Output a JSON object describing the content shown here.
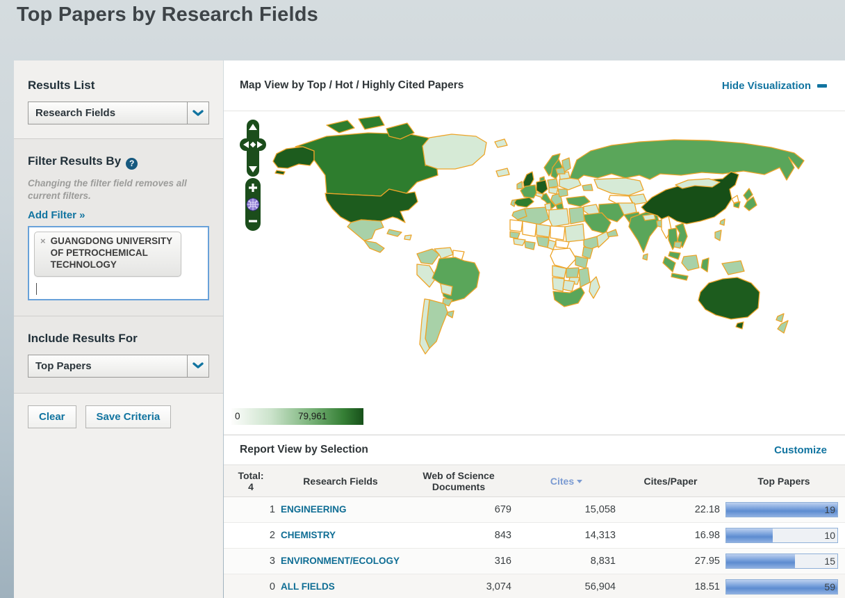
{
  "page": {
    "title": "Top Papers by Research Fields"
  },
  "sidebar": {
    "results_list": {
      "label": "Results List",
      "selected": "Research Fields"
    },
    "filter": {
      "heading": "Filter Results By",
      "help_icon": "?",
      "note": "Changing the filter field removes all current filters.",
      "add_filter_label": "Add Filter »",
      "chip": {
        "remove_icon": "×",
        "label": "GUANGDONG UNIVERSITY OF PETROCHEMICAL TECHNOLOGY"
      }
    },
    "include": {
      "label": "Include Results For",
      "selected": "Top Papers"
    },
    "actions": {
      "clear_label": "Clear",
      "save_label": "Save Criteria"
    }
  },
  "map_section": {
    "title": "Map View by Top / Hot / Highly Cited Papers",
    "hide_link": "Hide Visualization",
    "legend": {
      "min": "0",
      "max": "79,961",
      "min_color": "#ffffff",
      "max_color": "#17501a"
    },
    "border_color": "#eda428",
    "palette": {
      "0": "#ffffff",
      "1": "#f0f7f0",
      "2": "#d6ead6",
      "3": "#a8d1a8",
      "4": "#5aa65a",
      "5": "#2e7d2e",
      "6": "#1d5c1e",
      "7": "#174f17"
    },
    "country_levels": {
      "alaska": 6,
      "aleutians": 6,
      "canada": 5,
      "arctic-island-1": 5,
      "arctic-island-2": 5,
      "baffin": 5,
      "usa": 6,
      "mexico": 3,
      "central-america": 3,
      "cuba": 3,
      "hispaniola": 2,
      "greenland": 2,
      "iceland": 2,
      "svalbard": 2,
      "colombia": 3,
      "venezuela": 2,
      "guyana": 0,
      "peru": 2,
      "brazil": 4,
      "bolivia": 2,
      "paraguay": 3,
      "chile": 2,
      "argentina": 3,
      "uruguay": 3,
      "uk": 6,
      "ireland": 3,
      "france": 4,
      "spain": 5,
      "portugal": 3,
      "germany": 6,
      "italy": 4,
      "norway": 4,
      "sweden": 4,
      "finland": 3,
      "denmark": 4,
      "poland": 3,
      "czech-hungary": 2,
      "balkans": 3,
      "romania": 3,
      "ukraine": 2,
      "belarus": 2,
      "baltics": 3,
      "greece": 4,
      "alps": 2,
      "russia": 4,
      "kazakhstan": 2,
      "central-asia-west": 0,
      "central-asia-east": 2,
      "caucasus": 3,
      "turkey": 4,
      "syria-iraq": 2,
      "saudi-arabia": 4,
      "yemen-oman": 3,
      "iran": 4,
      "afghanistan": 2,
      "pakistan": 4,
      "india": 4,
      "nepal": 2,
      "bangladesh": 3,
      "sri-lanka": 3,
      "myanmar": 0,
      "thailand": 4,
      "vietnam": 4,
      "cambodia": 3,
      "malaysia": 4,
      "china": 7,
      "mongolia": 2,
      "north-korea": 0,
      "south-korea": 4,
      "japan-north": 4,
      "japan-south": 4,
      "taiwan": 3,
      "philippines": 3,
      "sumatra": 4,
      "java": 4,
      "borneo": 3,
      "sulawesi": 4,
      "new-guinea": 3,
      "morocco": 3,
      "algeria": 3,
      "tunisia": 2,
      "libya": 2,
      "egypt": 3,
      "mauritania": 0,
      "mali": 0,
      "niger": 2,
      "chad": 0,
      "sudan": 2,
      "ethiopia": 3,
      "somalia": 2,
      "senegal": 3,
      "guinea": 2,
      "nigeria": 3,
      "ghana": 3,
      "cameroon": 2,
      "central-african-republic": 0,
      "drc": 0,
      "kenya": 3,
      "tanzania": 3,
      "angola": 2,
      "zambia": 3,
      "mozambique": 3,
      "zimbabwe": 2,
      "namibia": 2,
      "botswana": 2,
      "south-africa": 4,
      "madagascar": 2,
      "australia": 6,
      "tasmania": 6,
      "new-zealand-north": 3,
      "new-zealand-south": 3
    }
  },
  "report": {
    "title": "Report View by Selection",
    "customize_label": "Customize",
    "table": {
      "rank_header_line1": "Total:",
      "rank_header_line2": "4",
      "columns": [
        "Research Fields",
        "Web of Science Documents",
        "Cites",
        "Cites/Paper",
        "Top Papers"
      ],
      "sorted_column": "Cites",
      "rows": [
        {
          "rank": "1",
          "field": "ENGINEERING",
          "documents": "679",
          "cites": "15,058",
          "cites_per_paper": "22.18",
          "top_papers_visible": "19",
          "bar_percent": 100
        },
        {
          "rank": "2",
          "field": "CHEMISTRY",
          "documents": "843",
          "cites": "14,313",
          "cites_per_paper": "16.98",
          "top_papers_visible": "10",
          "bar_percent": 42
        },
        {
          "rank": "3",
          "field": "ENVIRONMENT/ECOLOGY",
          "documents": "316",
          "cites": "8,831",
          "cites_per_paper": "27.95",
          "top_papers_visible": "15",
          "bar_percent": 62
        },
        {
          "rank": "0",
          "field": "ALL FIELDS",
          "documents": "3,074",
          "cites": "56,904",
          "cites_per_paper": "18.51",
          "top_papers_visible": "59",
          "bar_percent": 100
        }
      ]
    }
  }
}
